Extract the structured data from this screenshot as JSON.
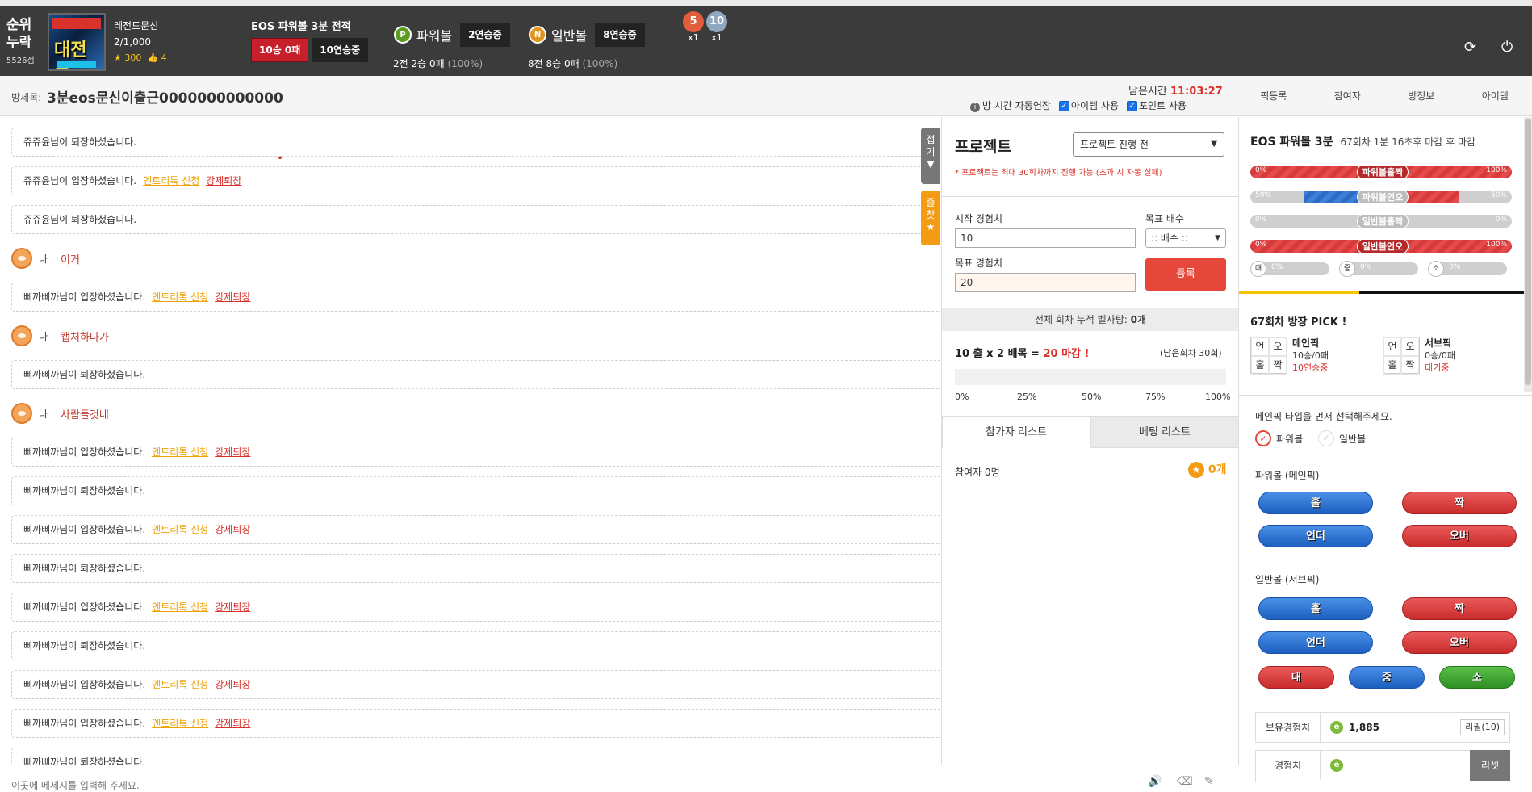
{
  "header": {
    "rank_line1": "순위",
    "rank_line2": "누락",
    "rank_score": "5526점",
    "avatar_text": "대전교",
    "user_name": "레전드문신",
    "user_count": "2/1,000",
    "stars": "300",
    "likes": "4",
    "eos_title": "EOS 파워볼 3분 전적",
    "eos_record": "10승 0패",
    "eos_streak": "10연승중",
    "powerball_coin": "P",
    "powerball_label": "파워볼",
    "powerball_streak": "2연승중",
    "powerball_sub": "2전 2승 0패",
    "powerball_pct": "(100%)",
    "normalball_coin": "N",
    "normalball_label": "일반볼",
    "normalball_streak": "8연승중",
    "normalball_sub": "8전 8승 0패",
    "normalball_pct": "(100%)",
    "medal1_num": "5",
    "medal1_count": "x1",
    "medal2_num": "10",
    "medal2_count": "x1",
    "refresh_icon": "refresh-icon",
    "power_icon": "power-icon"
  },
  "room": {
    "title_label": "방제목:",
    "title": "3분eos문신이출근0000000000000",
    "remain_label": "남은시간",
    "remain_time": "11:03:27",
    "auto_extend": "방 시간 자동연장",
    "use_item": "아이템 사용",
    "use_point": "포인트 사용",
    "tabs": [
      "픽등록",
      "참여자",
      "방정보",
      "아이템"
    ]
  },
  "chat": {
    "messages": [
      {
        "name": "쥬쥬윤",
        "text": "님이 퇴장하셨습니다."
      },
      {
        "name": "쥬쥬윤",
        "text": "님이 입장하셨습니다.",
        "link1": "엔트리톡 신청",
        "link2": "강제퇴장"
      },
      {
        "name": "쥬쥬윤",
        "text": "님이 퇴장하셨습니다."
      },
      {
        "mine": true,
        "me": "나",
        "text": "이거"
      },
      {
        "name": "삐까삐까",
        "text": "님이 입장하셨습니다.",
        "link1": "엔트리톡 신청",
        "link2": "강제퇴장"
      },
      {
        "mine": true,
        "me": "나",
        "text": "캡처하다가"
      },
      {
        "name": "삐까삐까",
        "text": "님이 퇴장하셨습니다."
      },
      {
        "mine": true,
        "me": "나",
        "text": "사람들것네"
      },
      {
        "name": "삐까삐까",
        "text": "님이 입장하셨습니다.",
        "link1": "엔트리톡 신청",
        "link2": "강제퇴장"
      },
      {
        "name": "삐까삐까",
        "text": "님이 퇴장하셨습니다."
      },
      {
        "name": "삐까삐까",
        "text": "님이 입장하셨습니다.",
        "link1": "엔트리톡 신청",
        "link2": "강제퇴장"
      },
      {
        "name": "삐까삐까",
        "text": "님이 퇴장하셨습니다."
      },
      {
        "name": "삐까삐까",
        "text": "님이 입장하셨습니다.",
        "link1": "엔트리톡 신청",
        "link2": "강제퇴장"
      },
      {
        "name": "삐까삐까",
        "text": "님이 퇴장하셨습니다."
      },
      {
        "name": "삐까삐까",
        "text": "님이 입장하셨습니다.",
        "link1": "엔트리톡 신청",
        "link2": "강제퇴장"
      },
      {
        "name": "삐까삐까",
        "text": "님이 입장하셨습니다.",
        "link1": "엔트리톡 신청",
        "link2": "강제퇴장"
      },
      {
        "name": "삐까삐까",
        "text": "님이 퇴장하셨습니다."
      }
    ],
    "fold_tab": "접기",
    "fav_tab": "즐찾",
    "placeholder": "이곳에 메세지를 입력해 주세요."
  },
  "project": {
    "title": "프로젝트",
    "select_value": "프로젝트 진행 전",
    "note": "* 프로젝트는 최대 30회차까지 진행 가능 (초과 시 자동 실패)",
    "start_exp_label": "시작 경험치",
    "start_exp_value": "10",
    "target_mult_label": "목표 배수",
    "target_mult_value": ":: 배수 ::",
    "target_exp_label": "목표 경험치",
    "target_exp_value": "20",
    "register": "등록",
    "cum_label": "전체 회차 누적 벨사탕:",
    "cum_value": "0개",
    "calc_prefix": "10 출 x 2 배목 =",
    "calc_result": "20 마감 !",
    "remain_rounds": "(남은회차 30회)",
    "progress": 0,
    "ticks": [
      "0%",
      "25%",
      "50%",
      "75%",
      "100%"
    ],
    "tab_participants": "참가자 리스트",
    "tab_bets": "베팅 리스트",
    "participants": "참여자 0명",
    "star_count": "0개"
  },
  "right": {
    "title": "EOS 파워볼 3분",
    "round_info": "67회차 1분 16초후 마감 후 마감",
    "bars": [
      {
        "left": "0%",
        "right": "100%",
        "label": "파워볼홀짝",
        "fill": 1.0,
        "color": "red"
      },
      {
        "left": "50%",
        "right": "50%",
        "label": "파워볼언오",
        "fill": 0.5,
        "color": "split"
      },
      {
        "left": "0%",
        "right": "0%",
        "label": "일반볼홀짝",
        "fill": 0,
        "color": "none"
      },
      {
        "left": "0%",
        "right": "100%",
        "label": "일반볼언오",
        "fill": 1.0,
        "color": "red"
      }
    ],
    "mini": [
      {
        "key": "대",
        "pct": "0%"
      },
      {
        "key": "중",
        "pct": "0%"
      },
      {
        "key": "소",
        "pct": "0%"
      }
    ],
    "pick_title": "67회차 방장 PICK !",
    "grid_main": [
      "언",
      "오",
      "홀",
      "짝"
    ],
    "main_label": "메인픽",
    "main_record": "10승/0패",
    "main_streak": "10연승중",
    "grid_sub": [
      "언",
      "오",
      "홀",
      "짝"
    ],
    "sub_label": "서브픽",
    "sub_record": "0승/0패",
    "sub_status": "대기중",
    "choose": "메인픽 타입을 먼저 선택해주세요.",
    "radio_power": "파워볼",
    "radio_normal": "일반볼",
    "sect_main": "파워볼 (메인픽)",
    "sect_sub": "일반볼 (서브픽)",
    "btn_odd": "홀",
    "btn_even": "짝",
    "btn_under": "언더",
    "btn_over": "오버",
    "btn_big": "대",
    "btn_mid": "중",
    "btn_small": "소",
    "owned_label": "보유경험치",
    "owned_value": "1,885",
    "refill": "리필(10)",
    "exp_label": "경험치",
    "reset": "리셋"
  }
}
